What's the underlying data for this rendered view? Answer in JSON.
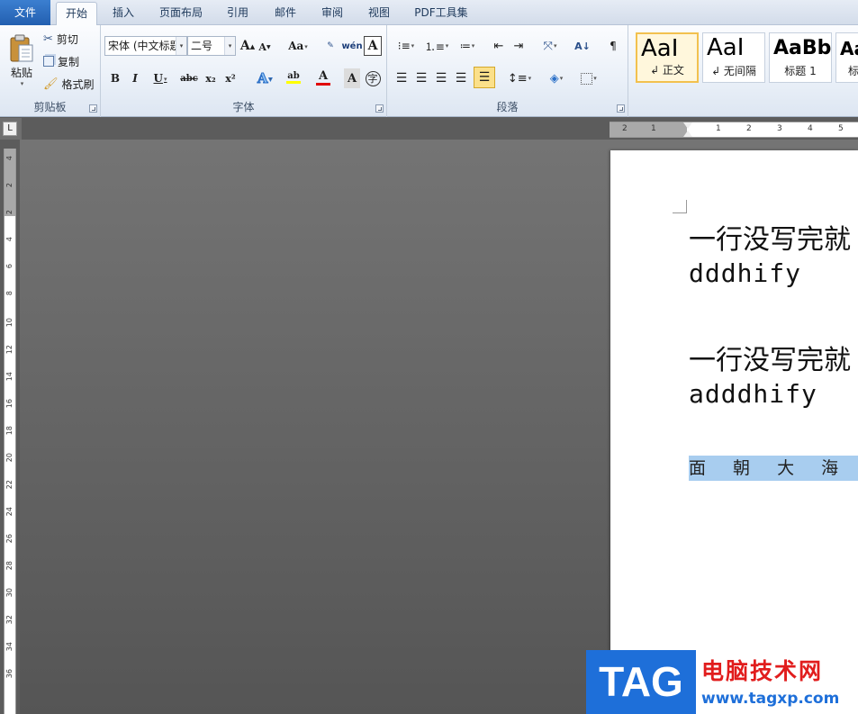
{
  "tabs": {
    "file": "文件",
    "home": "开始",
    "insert": "插入",
    "page_layout": "页面布局",
    "references": "引用",
    "mailings": "邮件",
    "review": "审阅",
    "view": "视图",
    "pdf_tools": "PDF工具集"
  },
  "clipboard": {
    "paste": "粘贴",
    "cut": "剪切",
    "copy": "复制",
    "format_painter": "格式刷",
    "group_label": "剪贴板"
  },
  "font": {
    "font_name": "宋体 (中文标题",
    "font_size": "二号",
    "grow_label": "A",
    "shrink_label": "A",
    "change_case": "Aa",
    "phonetic": "wén",
    "bold": "B",
    "italic": "I",
    "underline": "U",
    "strikethrough": "abc",
    "subscript": "x₂",
    "superscript": "x²",
    "text_effects": "A",
    "highlight": "ab",
    "font_color": "A",
    "char_shading": "A",
    "enclose": "字",
    "group_label": "字体"
  },
  "paragraph": {
    "group_label": "段落"
  },
  "styles": {
    "items": [
      {
        "sample": "AaI",
        "name": "↲ 正文"
      },
      {
        "sample": "AaI",
        "name": "↲ 无间隔"
      },
      {
        "sample": "AaBb",
        "name": "标题 1"
      },
      {
        "sample": "Aa",
        "name": "标"
      }
    ]
  },
  "ruler": {
    "h_numbers": [
      "2",
      "1",
      "1",
      "2",
      "3",
      "4",
      "5"
    ],
    "v_numbers": [
      "4",
      "2",
      "2",
      "4",
      "6",
      "8",
      "10",
      "12",
      "14",
      "16",
      "18",
      "20",
      "22",
      "24",
      "26",
      "28",
      "30",
      "32",
      "34",
      "36"
    ]
  },
  "document": {
    "line1": "一行没写完就",
    "line2": "dddhify",
    "line3": "一行没写完就",
    "line4": "adddhify",
    "selected_text": "面 朝 大 海"
  },
  "watermark": {
    "tag": "TAG",
    "title": "电脑技术网",
    "url": "www.tagxp.com"
  },
  "colors": {
    "file_tab": "#235fb0",
    "selection": "#a8cdef",
    "font_color_bar": "#e00000",
    "highlight_bar": "#ffff00"
  }
}
